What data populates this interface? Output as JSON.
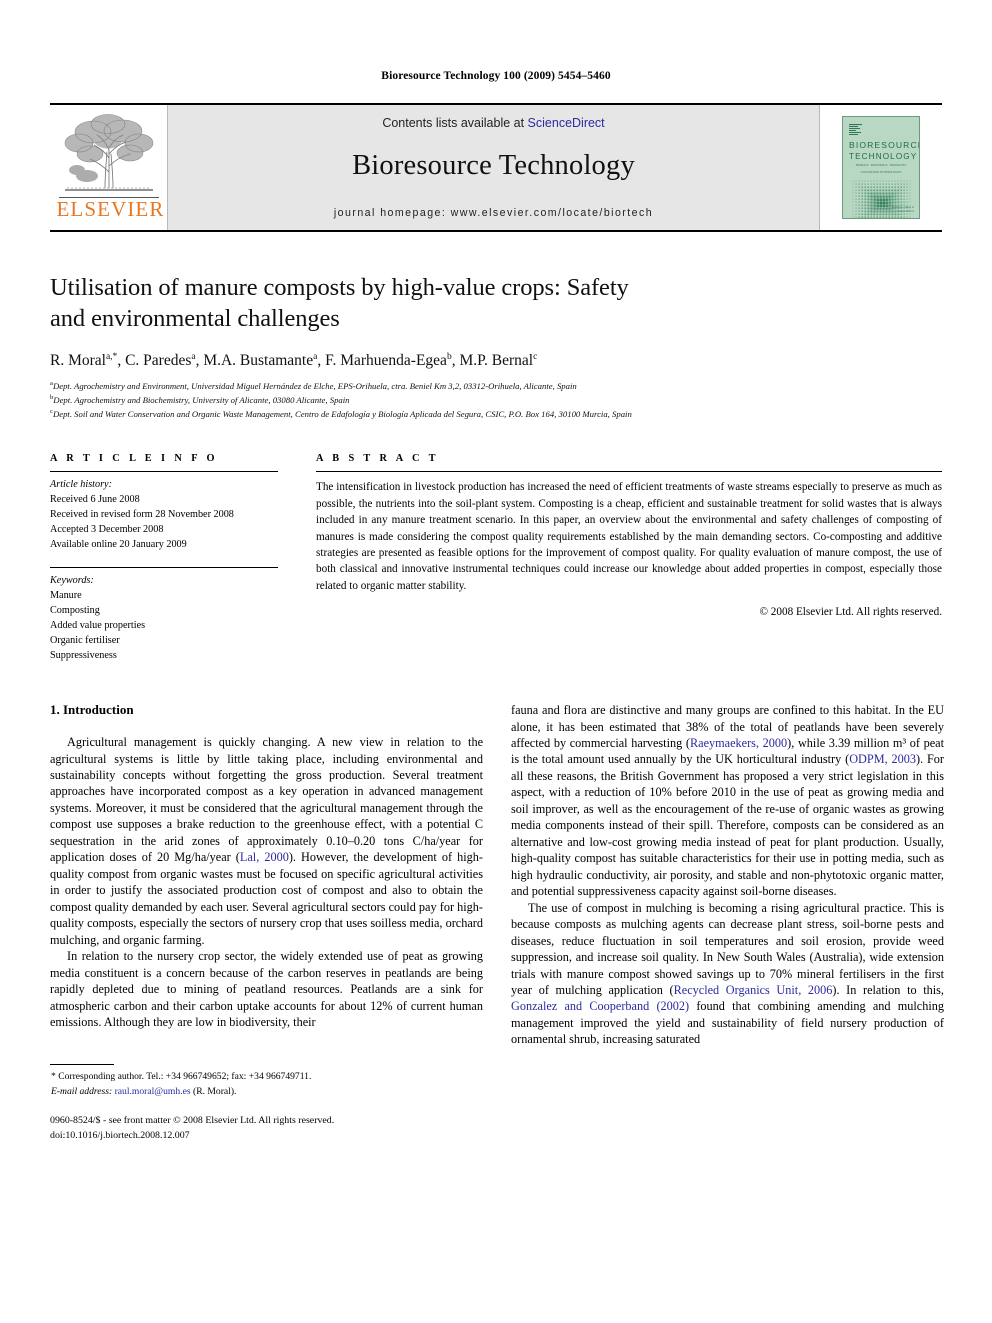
{
  "running_head": "Bioresource Technology 100 (2009) 5454–5460",
  "masthead": {
    "contents_prefix": "Contents lists available at ",
    "sciencedirect": "ScienceDirect",
    "journal_name": "Bioresource Technology",
    "homepage": "journal homepage: www.elsevier.com/locate/biortech",
    "elsevier_wordmark": "ELSEVIER",
    "elsevier_accent_color": "#E87722",
    "link_color": "#2b2ba0",
    "banner_bg": "#e6e6e6",
    "cover": {
      "line1": "BIORESOURCE",
      "line2": "TECHNOLOGY",
      "sub1": "BIOMASS · BIOENERGY · BIOWASTES",
      "sub2": "CONVERSION TECHNOLOGIES",
      "sub3": "BIOTRANSFORMATIONS",
      "sub4": "PRODUCTION TECHNOLOGIES",
      "foot1": "Available online at",
      "foot2": "ScienceDirect",
      "bg_color": "#b9d8c4",
      "ink_color": "#1c6b44"
    }
  },
  "article": {
    "title_line1": "Utilisation of manure composts by high-value crops: Safety",
    "title_line2": "and environmental challenges",
    "authors": [
      {
        "name": "R. Moral",
        "sup": "a,*"
      },
      {
        "name": "C. Paredes",
        "sup": "a"
      },
      {
        "name": "M.A. Bustamante",
        "sup": "a"
      },
      {
        "name": "F. Marhuenda-Egea",
        "sup": "b"
      },
      {
        "name": "M.P. Bernal",
        "sup": "c"
      }
    ],
    "affiliations": [
      {
        "marker": "a",
        "text": "Dept. Agrochemistry and Environment, Universidad Miguel Hernández de Elche, EPS-Orihuela, ctra. Beniel Km 3,2, 03312-Orihuela, Alicante, Spain"
      },
      {
        "marker": "b",
        "text": "Dept. Agrochemistry and Biochemistry, University of Alicante, 03080 Alicante, Spain"
      },
      {
        "marker": "c",
        "text": "Dept. Soil and Water Conservation and Organic Waste Management, Centro de Edafología y Biología Aplicada del Segura, CSIC, P.O. Box 164, 30100 Murcia, Spain"
      }
    ]
  },
  "article_info": {
    "heading": "A R T I C L E  I N F O",
    "history_label": "Article history:",
    "history": [
      "Received 6 June 2008",
      "Received in revised form 28 November 2008",
      "Accepted 3 December 2008",
      "Available online 20 January 2009"
    ],
    "keywords_label": "Keywords:",
    "keywords": [
      "Manure",
      "Composting",
      "Added value properties",
      "Organic fertiliser",
      "Suppressiveness"
    ]
  },
  "abstract": {
    "heading": "A B S T R A C T",
    "text": "The intensification in livestock production has increased the need of efficient treatments of waste streams especially to preserve as much as possible, the nutrients into the soil-plant system. Composting is a cheap, efficient and sustainable treatment for solid wastes that is always included in any manure treatment scenario. In this paper, an overview about the environmental and safety challenges of composting of manures is made considering the compost quality requirements established by the main demanding sectors. Co-composting and additive strategies are presented as feasible options for the improvement of compost quality. For quality evaluation of manure compost, the use of both classical and innovative instrumental techniques could increase our knowledge about added properties in compost, especially those related to organic matter stability.",
    "copyright": "© 2008 Elsevier Ltd. All rights reserved."
  },
  "body": {
    "section_heading": "1. Introduction",
    "left_paragraphs": [
      {
        "parts": [
          {
            "t": "Agricultural management is quickly changing. A new view in relation to the agricultural systems is little by little taking place, including environmental and sustainability concepts without forgetting the gross production. Several treatment approaches have incorporated compost as a key operation in advanced management systems. Moreover, it must be considered that the agricultural management through the compost use supposes a brake reduction to the greenhouse effect, with a potential C sequestration in the arid zones of approximately 0.10–0.20 tons C/ha/year for application doses of 20 Mg/ha/year ("
          },
          {
            "t": "Lal, 2000",
            "cite": true
          },
          {
            "t": "). However, the development of high-quality compost from organic wastes must be focused on specific agricultural activities in order to justify the associated production cost of compost and also to obtain the compost quality demanded by each user. Several agricultural sectors could pay for high-quality composts, especially the sectors of nursery crop that uses soilless media, orchard mulching, and organic farming."
          }
        ]
      },
      {
        "parts": [
          {
            "t": "In relation to the nursery crop sector, the widely extended use of peat as growing media constituent is a concern because of the carbon reserves in peatlands are being rapidly depleted due to mining of peatland resources. Peatlands are a sink for atmospheric carbon and their carbon uptake accounts for about 12% of current human emissions. Although they are low in biodiversity, their"
          }
        ]
      }
    ],
    "right_paragraphs": [
      {
        "parts": [
          {
            "t": "fauna and flora are distinctive and many groups are confined to this habitat. In the EU alone, it has been estimated that 38% of the total of peatlands have been severely affected by commercial harvesting ("
          },
          {
            "t": "Raeymaekers, 2000",
            "cite": true
          },
          {
            "t": "), while 3.39 million m³ of peat is the total amount used annually by the UK horticultural industry ("
          },
          {
            "t": "ODPM, 2003",
            "cite": true
          },
          {
            "t": "). For all these reasons, the British Government has proposed a very strict legislation in this aspect, with a reduction of 10% before 2010 in the use of peat as growing media and soil improver, as well as the encouragement of the re-use of organic wastes as growing media components instead of their spill. Therefore, composts can be considered as an alternative and low-cost growing media instead of peat for plant production. Usually, high-quality compost has suitable characteristics for their use in potting media, such as high hydraulic conductivity, air porosity, and stable and non-phytotoxic organic matter, and potential suppressiveness capacity against soil-borne diseases."
          }
        ]
      },
      {
        "parts": [
          {
            "t": "The use of compost in mulching is becoming a rising agricultural practice. This is because composts as mulching agents can decrease plant stress, soil-borne pests and diseases, reduce fluctuation in soil temperatures and soil erosion, provide weed suppression, and increase soil quality. In New South Wales (Australia), wide extension trials with manure compost showed savings up to 70% mineral fertilisers in the first year of mulching application ("
          },
          {
            "t": "Recycled Organics Unit, 2006",
            "cite": true
          },
          {
            "t": "). In relation to this, "
          },
          {
            "t": "Gonzalez and Cooperband (2002)",
            "cite": true
          },
          {
            "t": " found that combining amending and mulching management improved the yield and sustainability of field nursery production of ornamental shrub, increasing saturated"
          }
        ]
      }
    ]
  },
  "footnote": {
    "corresponding": "* Corresponding author. Tel.: +34 966749652; fax: +34 966749711.",
    "email_label": "E-mail address:",
    "email": "raul.moral@umh.es",
    "email_owner": "(R. Moral).",
    "issn_line": "0960-8524/$ - see front matter © 2008 Elsevier Ltd. All rights reserved.",
    "doi_line": "doi:10.1016/j.biortech.2008.12.007"
  }
}
